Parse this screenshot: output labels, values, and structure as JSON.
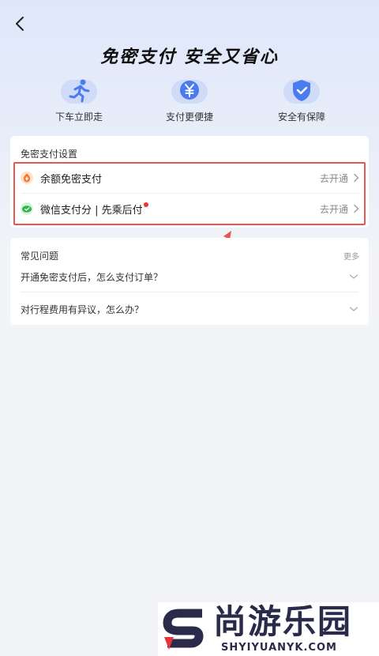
{
  "header": {
    "title": "免密支付 安全又省心"
  },
  "features": [
    {
      "label": "下车立即走",
      "icon": "running-person-icon"
    },
    {
      "label": "支付更便捷",
      "icon": "yen-coin-icon"
    },
    {
      "label": "安全有保障",
      "icon": "shield-check-icon"
    }
  ],
  "settings": {
    "title": "免密支付设置",
    "items": [
      {
        "label": "余额免密支付",
        "action": "去开通",
        "icon": "balance-coin-icon"
      },
      {
        "label": "微信支付分 | 先乘后付",
        "action": "去开通",
        "icon": "wechat-pay-icon"
      }
    ]
  },
  "faq": {
    "title": "常见问题",
    "more": "更多",
    "items": [
      {
        "question": "开通免密支付后，怎么支付订单？"
      },
      {
        "question": "对行程费用有异议，怎么办？"
      }
    ]
  },
  "watermark": {
    "brand": "尚游乐园",
    "domain": "SHYIYUANYK.COM"
  },
  "colors": {
    "accent_blue": "#4a7cf0",
    "highlight_red": "#e8564d",
    "wechat_green": "#2db84a",
    "coin_orange": "#f07a2a"
  }
}
